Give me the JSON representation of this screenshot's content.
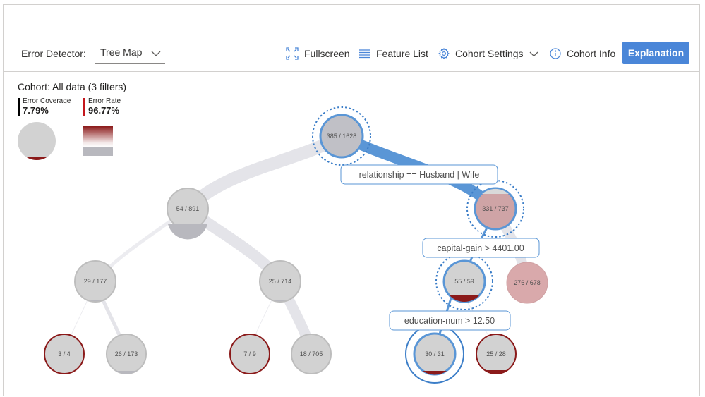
{
  "toolbar": {
    "detector_label": "Error Detector:",
    "view_selected": "Tree Map",
    "fullscreen_label": "Fullscreen",
    "feature_list_label": "Feature List",
    "cohort_settings_label": "Cohort Settings",
    "cohort_info_label": "Cohort Info",
    "explanation_label": "Explanation"
  },
  "cohort": {
    "title": "Cohort: All data (3 filters)",
    "coverage_label": "Error Coverage",
    "coverage_value": "7.79%",
    "rate_label": "Error Rate",
    "rate_value": "96.77%"
  },
  "colors": {
    "accent": "#4a86d8",
    "error": "#8b1a1a",
    "node_gray": "#cfcfcf",
    "path_gray": "#e1e1e6",
    "selected_path": "#5a96d6"
  },
  "tree": {
    "nodes": [
      {
        "label": "385 / 1628"
      },
      {
        "label": "54 / 891"
      },
      {
        "label": "331 / 737"
      },
      {
        "label": "29 / 177"
      },
      {
        "label": "25 / 714"
      },
      {
        "label": "55 / 59"
      },
      {
        "label": "276 / 678"
      },
      {
        "label": "3 / 4"
      },
      {
        "label": "26 / 173"
      },
      {
        "label": "7 / 9"
      },
      {
        "label": "18 / 705"
      },
      {
        "label": "30 / 31"
      },
      {
        "label": "25 / 28"
      }
    ],
    "conditions": [
      {
        "label": "relationship == Husband | Wife"
      },
      {
        "label": "capital-gain > 4401.00"
      },
      {
        "label": "education-num > 12.50"
      }
    ]
  }
}
